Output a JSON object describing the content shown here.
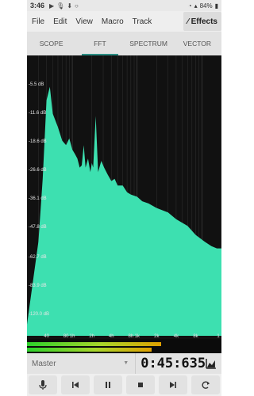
{
  "status": {
    "time": "3:46",
    "battery": "84%"
  },
  "menu": {
    "items": [
      "File",
      "Edit",
      "View",
      "Macro",
      "Track"
    ],
    "effects_label": "Effects"
  },
  "tabs": [
    {
      "label": "SCOPE",
      "active": false
    },
    {
      "label": "FFT",
      "active": true
    },
    {
      "label": "SPECTRUM",
      "active": false
    },
    {
      "label": "VECTOR",
      "active": false
    }
  ],
  "chart_data": {
    "type": "area",
    "title": "",
    "xlabel": "",
    "ylabel": "",
    "y_tick_labels": [
      "-5.5 dB",
      "-11.6 dB",
      "-18.6 dB",
      "-26.6 dB",
      "-36.1 dB",
      "-47.8 dB",
      "-62.7 dB",
      "-83.9 dB",
      "-120.0 dB"
    ],
    "x_tick_labels": [
      "40",
      "80",
      "1h",
      "2h",
      "4h",
      "8h",
      "1k",
      "2k",
      "4k",
      "8k",
      "1"
    ],
    "color": "#3de0b0",
    "series": [
      {
        "values": [
          {
            "x": 20,
            "y": -120
          },
          {
            "x": 30,
            "y": -83
          },
          {
            "x": 35,
            "y": -55
          },
          {
            "x": 40,
            "y": -20
          },
          {
            "x": 45,
            "y": -14
          },
          {
            "x": 50,
            "y": -26
          },
          {
            "x": 60,
            "y": -32
          },
          {
            "x": 70,
            "y": -38
          },
          {
            "x": 80,
            "y": -40
          },
          {
            "x": 90,
            "y": -37
          },
          {
            "x": 100,
            "y": -42
          },
          {
            "x": 110,
            "y": -44
          },
          {
            "x": 120,
            "y": -46
          },
          {
            "x": 130,
            "y": -50
          },
          {
            "x": 140,
            "y": -49
          },
          {
            "x": 150,
            "y": -40
          },
          {
            "x": 160,
            "y": -50
          },
          {
            "x": 175,
            "y": -46
          },
          {
            "x": 190,
            "y": -52
          },
          {
            "x": 200,
            "y": -48
          },
          {
            "x": 210,
            "y": -50
          },
          {
            "x": 230,
            "y": -27
          },
          {
            "x": 250,
            "y": -52
          },
          {
            "x": 280,
            "y": -47
          },
          {
            "x": 310,
            "y": -50
          },
          {
            "x": 350,
            "y": -53
          },
          {
            "x": 400,
            "y": -56
          },
          {
            "x": 450,
            "y": -55
          },
          {
            "x": 500,
            "y": -58
          },
          {
            "x": 600,
            "y": -58
          },
          {
            "x": 700,
            "y": -61
          },
          {
            "x": 800,
            "y": -62
          },
          {
            "x": 1000,
            "y": -63
          },
          {
            "x": 1200,
            "y": -65
          },
          {
            "x": 1500,
            "y": -66
          },
          {
            "x": 2000,
            "y": -68
          },
          {
            "x": 3000,
            "y": -70
          },
          {
            "x": 4000,
            "y": -73
          },
          {
            "x": 6000,
            "y": -76
          },
          {
            "x": 8000,
            "y": -80
          },
          {
            "x": 11000,
            "y": -83
          },
          {
            "x": 14000,
            "y": -85
          },
          {
            "x": 17000,
            "y": -86
          },
          {
            "x": 20000,
            "y": -86
          }
        ]
      }
    ]
  },
  "meters": [
    {
      "level": 0.69,
      "color": "#e0a000"
    },
    {
      "level": 0.64,
      "color": "#e0a000"
    }
  ],
  "transport": {
    "track": "Master",
    "time": "0:45:635"
  }
}
